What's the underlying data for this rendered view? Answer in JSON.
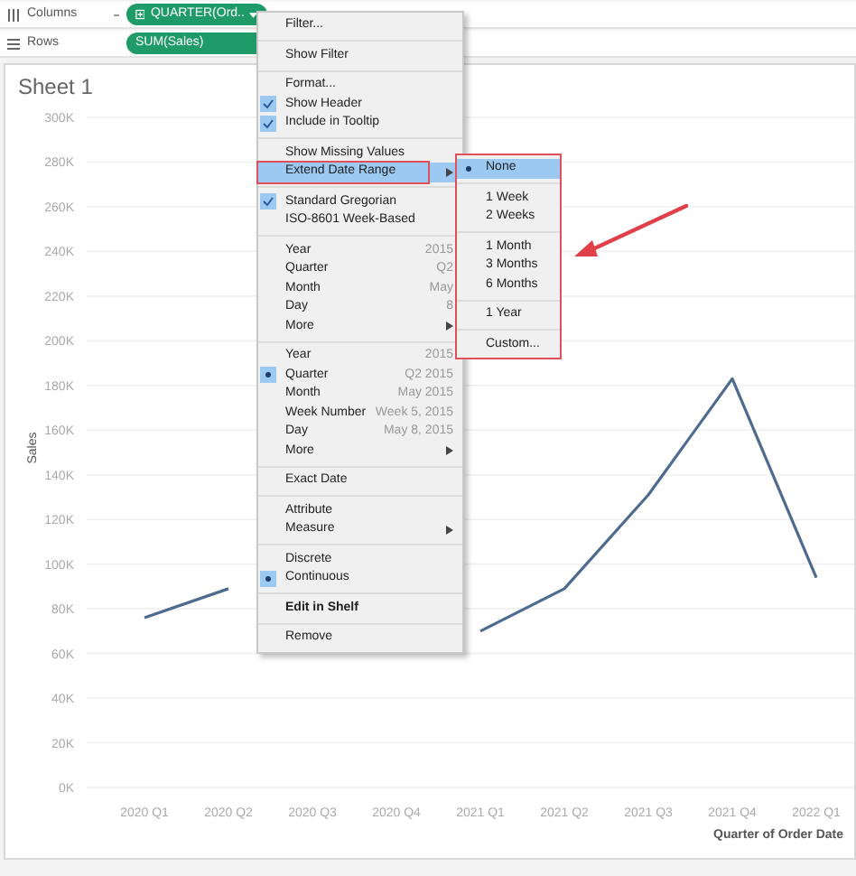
{
  "shelves": [
    {
      "kind": "columns",
      "label": "Columns",
      "pill": "QUARTER(Ord.."
    },
    {
      "kind": "rows",
      "label": "Rows",
      "pill": "SUM(Sales)"
    }
  ],
  "sheet": {
    "title": "Sheet 1",
    "chart_data": {
      "type": "line",
      "xlabel": "Quarter of Order Date",
      "ylabel": "Sales",
      "categories": [
        "2020 Q1",
        "2020 Q2",
        "2020 Q3",
        "2020 Q4",
        "2021 Q1",
        "2021 Q2",
        "2021 Q3",
        "2021 Q4",
        "2022 Q1"
      ],
      "series": [
        {
          "color": "#4e6a8f",
          "values": [
            76000,
            89000,
            null,
            null,
            70000,
            89000,
            131000,
            183000,
            94000
          ]
        }
      ],
      "ylim": [
        0,
        300000
      ],
      "grid": true,
      "yticks": [
        {
          "value": 0,
          "label": "0K"
        },
        {
          "value": 20000,
          "label": "20K"
        },
        {
          "value": 40000,
          "label": "40K"
        },
        {
          "value": 60000,
          "label": "60K"
        },
        {
          "value": 80000,
          "label": "80K"
        },
        {
          "value": 100000,
          "label": "100K"
        },
        {
          "value": 120000,
          "label": "120K"
        },
        {
          "value": 140000,
          "label": "140K"
        },
        {
          "value": 160000,
          "label": "160K"
        },
        {
          "value": 180000,
          "label": "180K"
        },
        {
          "value": 200000,
          "label": "200K"
        },
        {
          "value": 220000,
          "label": "220K"
        },
        {
          "value": 240000,
          "label": "240K"
        },
        {
          "value": 260000,
          "label": "260K"
        },
        {
          "value": 280000,
          "label": "280K"
        },
        {
          "value": 300000,
          "label": "300K"
        }
      ]
    }
  },
  "menu": {
    "groups": [
      [
        {
          "label": "Filter...",
          "kind": "plain"
        }
      ],
      [
        {
          "label": "Show Filter",
          "kind": "plain"
        }
      ],
      [
        {
          "label": "Format...",
          "kind": "plain"
        },
        {
          "label": "Show Header",
          "kind": "check",
          "checked": true
        },
        {
          "label": "Include in Tooltip",
          "kind": "check",
          "checked": true
        }
      ],
      [
        {
          "label": "Show Missing Values",
          "kind": "plain"
        },
        {
          "label": "Extend Date Range",
          "kind": "plain",
          "submenu": true,
          "highlighted": true
        }
      ],
      [
        {
          "label": "Standard Gregorian",
          "kind": "check",
          "checked": true
        },
        {
          "label": "ISO-8601 Week-Based",
          "kind": "plain"
        }
      ],
      [
        {
          "label": "Year",
          "kind": "plain",
          "value": "2015"
        },
        {
          "label": "Quarter",
          "kind": "plain",
          "value": "Q2"
        },
        {
          "label": "Month",
          "kind": "plain",
          "value": "May"
        },
        {
          "label": "Day",
          "kind": "plain",
          "value": "8"
        },
        {
          "label": "More",
          "kind": "plain",
          "submenu": true
        }
      ],
      [
        {
          "label": "Year",
          "kind": "radio",
          "selected": false,
          "value": "2015"
        },
        {
          "label": "Quarter",
          "kind": "radio",
          "selected": true,
          "value": "Q2 2015"
        },
        {
          "label": "Month",
          "kind": "radio",
          "selected": false,
          "value": "May 2015"
        },
        {
          "label": "Week Number",
          "kind": "radio",
          "selected": false,
          "value": "Week 5, 2015"
        },
        {
          "label": "Day",
          "kind": "radio",
          "selected": false,
          "value": "May 8, 2015"
        },
        {
          "label": "More",
          "kind": "plain",
          "submenu": true
        }
      ],
      [
        {
          "label": "Exact Date",
          "kind": "plain"
        }
      ],
      [
        {
          "label": "Attribute",
          "kind": "plain"
        },
        {
          "label": "Measure",
          "kind": "plain",
          "submenu": true
        }
      ],
      [
        {
          "label": "Discrete",
          "kind": "radio",
          "selected": false
        },
        {
          "label": "Continuous",
          "kind": "radio",
          "selected": true
        }
      ],
      [
        {
          "label": "Edit in Shelf",
          "kind": "plain",
          "bold": true
        }
      ],
      [
        {
          "label": "Remove",
          "kind": "plain"
        }
      ]
    ]
  },
  "submenu": {
    "groups": [
      [
        {
          "label": "None",
          "selected": true
        }
      ],
      [
        {
          "label": "1 Week",
          "selected": false
        },
        {
          "label": "2 Weeks",
          "selected": false
        }
      ],
      [
        {
          "label": "1 Month",
          "selected": false
        },
        {
          "label": "3 Months",
          "selected": false
        },
        {
          "label": "6 Months",
          "selected": false
        }
      ],
      [
        {
          "label": "1 Year",
          "selected": false
        }
      ],
      [
        {
          "label": "Custom...",
          "selected": false
        }
      ]
    ]
  }
}
